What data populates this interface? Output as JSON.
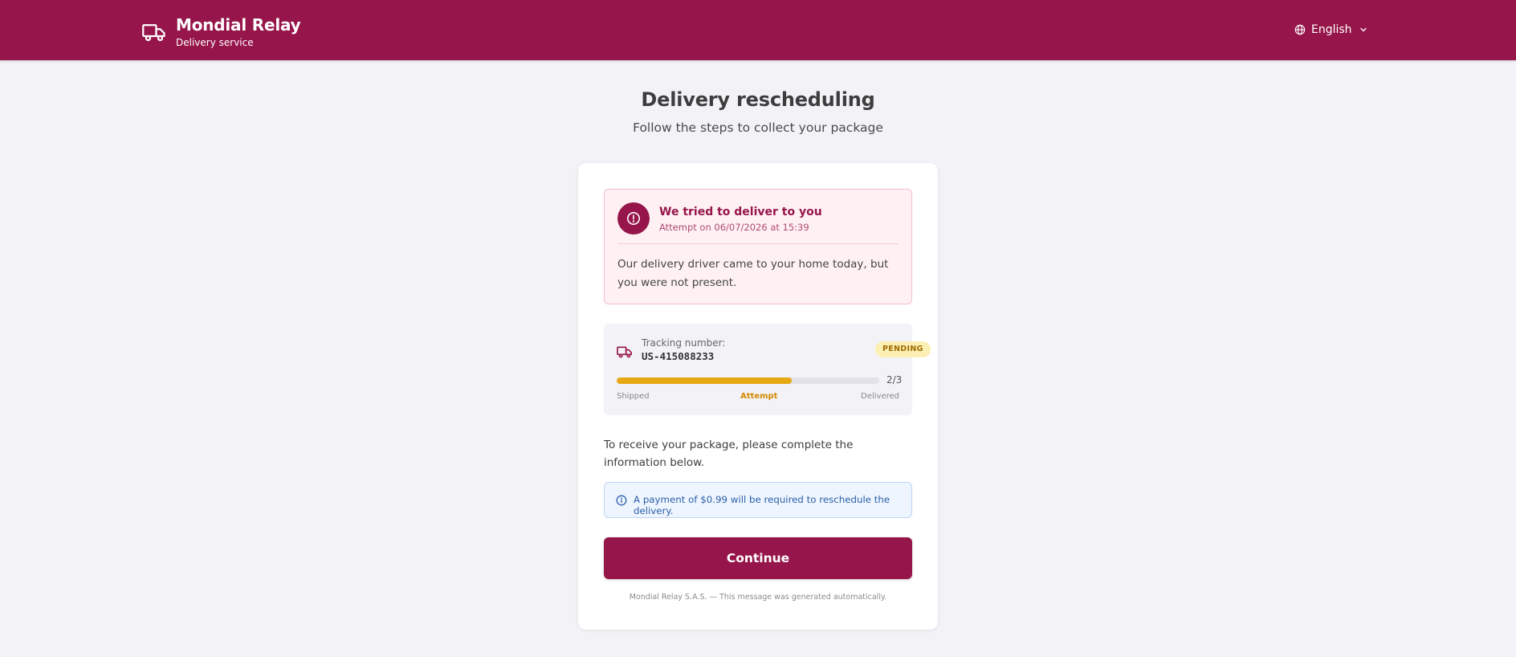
{
  "header": {
    "brand_name": "Mondial Relay",
    "brand_subtitle": "Delivery service",
    "language": "English",
    "background_color": "#96154a",
    "icons": [
      "truck-icon",
      "globe-icon",
      "chevron-down-icon"
    ]
  },
  "page": {
    "title": "Delivery rescheduling",
    "subtitle": "Follow the steps to collect your package"
  },
  "alert": {
    "title": "We tried to deliver to you",
    "timestamp": "Attempt on 06/07/2026 at 15:39",
    "body": "Our delivery driver came to your home today, but you were not present.",
    "icon": "exclamation-circle-icon"
  },
  "tracking": {
    "label": "Tracking number:",
    "number": "US-415088233",
    "status": "PENDING",
    "progress_fraction": 0.667,
    "progress_text": "2/3",
    "steps": [
      "Shipped",
      "Attempt",
      "Delivered"
    ],
    "current_step": "Attempt",
    "progress_color": "#e6a813"
  },
  "instructions": "To receive your package, please complete the information below.",
  "info": {
    "text": "A payment of $0.99 will be required to reschedule the delivery.",
    "icon": "info-icon"
  },
  "continue_label": "Continue",
  "footer": "Mondial Relay S.A.S. — This message was generated automatically."
}
